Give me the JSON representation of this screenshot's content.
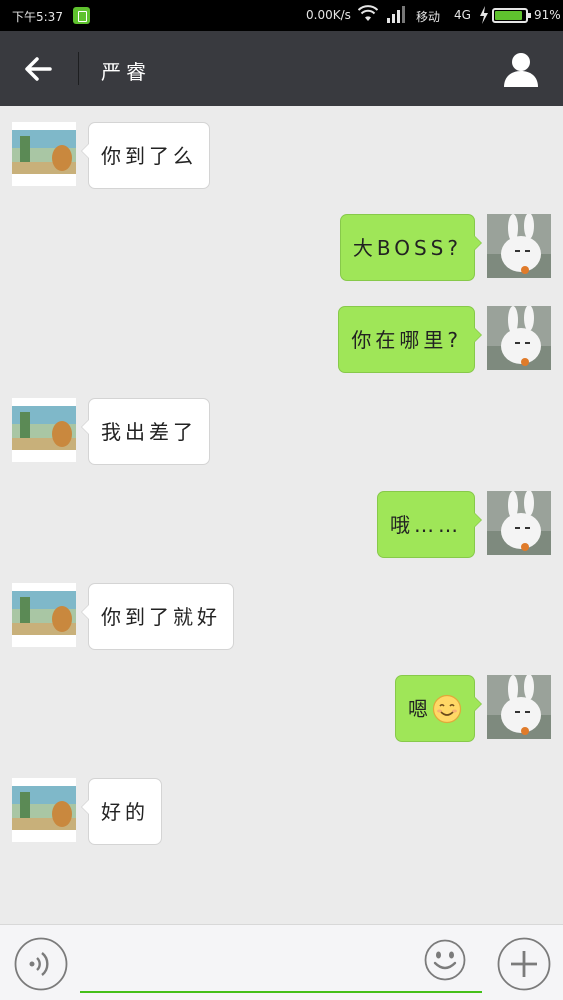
{
  "status_bar": {
    "time": "下午5:37",
    "net_speed": "0.00K/s",
    "carrier": "移动",
    "network": "4G",
    "battery_percent": "91%",
    "battery_level": 0.91
  },
  "header": {
    "title": "严睿",
    "back_icon": "arrow-left-icon",
    "profile_icon": "person-icon"
  },
  "messages": [
    {
      "direction": "in",
      "text": "你到了么"
    },
    {
      "direction": "out",
      "text": "大BOSS?"
    },
    {
      "direction": "out",
      "text": "你在哪里?"
    },
    {
      "direction": "in",
      "text": "我出差了"
    },
    {
      "direction": "out",
      "text": "哦……"
    },
    {
      "direction": "in",
      "text": "你到了就好"
    },
    {
      "direction": "out",
      "text": "嗯",
      "emoji": "smiley-face-icon"
    },
    {
      "direction": "in",
      "text": "好的"
    }
  ],
  "input_bar": {
    "voice_icon": "voice-input-icon",
    "emoji_icon": "emoji-face-icon",
    "plus_icon": "plus-icon",
    "text_value": ""
  },
  "colors": {
    "header_bg": "#393a3f",
    "outgoing_bubble": "#9fe658",
    "incoming_bubble": "#ffffff",
    "chat_bg": "#ebebeb",
    "input_underline": "#45c01a"
  }
}
